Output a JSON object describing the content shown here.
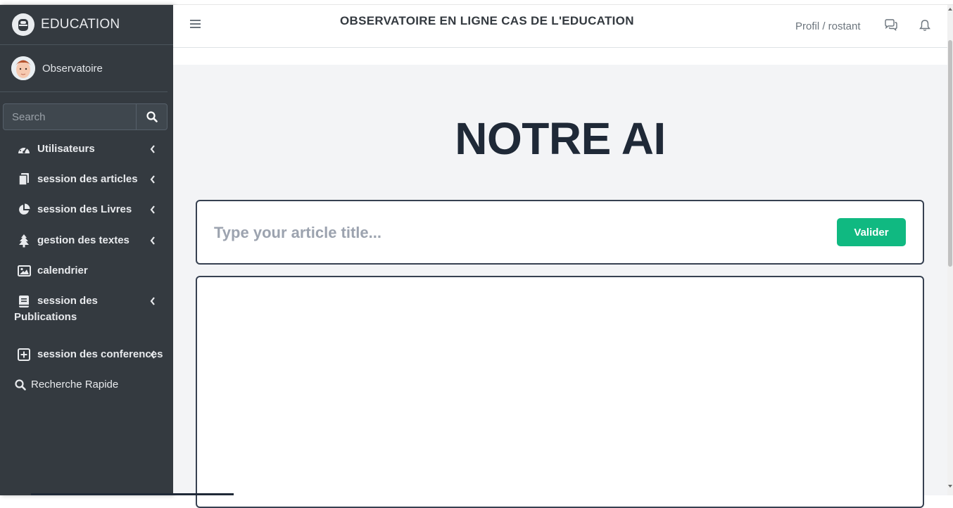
{
  "brand": {
    "name": "EDUCATION"
  },
  "user": {
    "name": "Observatoire"
  },
  "search": {
    "placeholder": "Search"
  },
  "sidebar": {
    "items": [
      {
        "label": "Utilisateurs",
        "icon": "tachometer-icon",
        "has_chevron": true
      },
      {
        "label": "session des articles",
        "icon": "copy-icon",
        "has_chevron": true
      },
      {
        "label": "session des Livres",
        "icon": "pie-chart-icon",
        "has_chevron": true
      },
      {
        "label": "gestion des textes",
        "icon": "tree-icon",
        "has_chevron": true
      },
      {
        "label": "calendrier",
        "icon": "image-icon",
        "has_chevron": false
      },
      {
        "label": "session des",
        "label_line2": "Publications",
        "icon": "book-icon",
        "has_chevron": true
      },
      {
        "label": "session des conferences",
        "icon": "plus-square-icon",
        "has_chevron": true
      },
      {
        "label": "Recherche Rapide",
        "icon": "search-icon",
        "has_chevron": false
      }
    ]
  },
  "header": {
    "title": "OBSERVATOIRE EN LIGNE CAS DE L'EDUCATION",
    "profile_link": "Profil / rostant"
  },
  "main": {
    "heading": "NOTRE AI",
    "title_input": {
      "placeholder": "Type your article title...",
      "value": ""
    },
    "submit_label": "Valider"
  },
  "colors": {
    "sidebar_bg": "#343a40",
    "accent_green": "#10b981",
    "heading": "#1f2937",
    "main_bg": "#f3f4f6"
  }
}
